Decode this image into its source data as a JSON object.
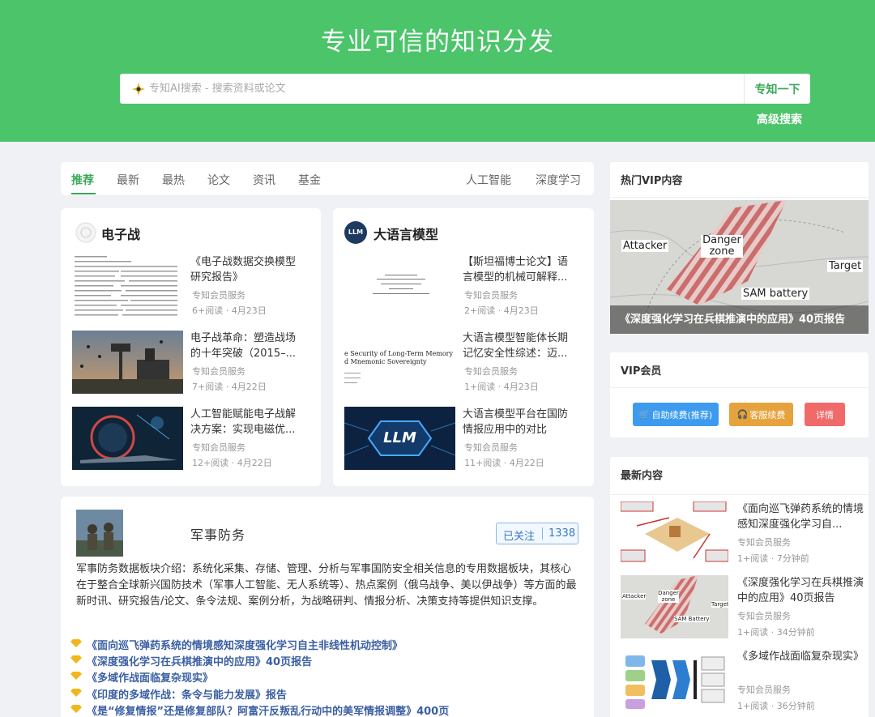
{
  "hero": {
    "title": "专业可信的知识分发",
    "search_placeholder": "专知AI搜索 - 搜索资料或论文",
    "search_button": "专知一下",
    "advanced": "高级搜索"
  },
  "tabs": {
    "left": [
      "推荐",
      "最新",
      "最热",
      "论文",
      "资讯",
      "基金"
    ],
    "right": [
      "人工智能",
      "深度学习"
    ],
    "active": "推荐"
  },
  "topics": [
    {
      "title": "电子战",
      "articles": [
        {
          "title": "《电子战数据交换模型研究报告》",
          "source": "专知会员服务",
          "meta": "6+阅读 · 4月23日"
        },
        {
          "title": "电子战革命：塑造战场的十年突破（2015–...",
          "source": "专知会员服务",
          "meta": "7+阅读 · 4月22日"
        },
        {
          "title": "人工智能赋能电子战解决方案：实现电磁优...",
          "source": "专知会员服务",
          "meta": "12+阅读 · 4月22日"
        }
      ]
    },
    {
      "title": "大语言模型",
      "logo_text": "LLM",
      "articles": [
        {
          "title": "【斯坦福博士论文】语言模型的机械可解释...",
          "source": "专知会员服务",
          "meta": "2+阅读 · 4月23日"
        },
        {
          "title": "大语言模型智能体长期记忆安全性综述：迈...",
          "source": "专知会员服务",
          "meta": "1+阅读 · 4月23日",
          "thumb_text": [
            "e Security of Long-Term Memory",
            "d Mnemonic Sovereignty"
          ]
        },
        {
          "title": "大语言模型平台在国防情报应用中的对比",
          "source": "专知会员服务",
          "meta": "11+阅读 · 4月22日",
          "thumb_text": [
            "LLM"
          ]
        }
      ]
    }
  ],
  "military": {
    "title": "军事防务",
    "follow_label": "已关注",
    "follow_count": "1338",
    "description": "军事防务数据板块介绍：系统化采集、存储、管理、分析与军事国防安全相关信息的专用数据板块，其核心在于整合全球新兴国防技术（军事人工智能、无人系统等）、热点案例（俄乌战争、美以伊战争）等方面的最新时讯、研究报告/论文、条令法规、案例分析，为战略研判、情报分析、决策支持等提供知识支撑。",
    "links": [
      "《面向巡飞弹药系统的情境感知深度强化学习自主非线性机动控制》",
      "《深度强化学习在兵棋推演中的应用》40页报告",
      "《多域作战面临复杂现实》",
      "《印度的多域作战：条令与能力发展》报告",
      "《是“修复情报”还是修复部队？阿富汗反叛乱行动中的美军情报调整》400页"
    ]
  },
  "sidebar": {
    "hot_vip": {
      "heading": "热门VIP内容",
      "caption": "《深度强化学习在兵棋推演中的应用》40页报告",
      "map_labels": {
        "attacker": "Attacker",
        "danger": "Danger zone",
        "target": "Target",
        "sam": "SAM battery"
      }
    },
    "vip": {
      "heading": "VIP会员",
      "buttons": [
        "自助续费(推荐)",
        "客服续费",
        "详情"
      ],
      "colors": {
        "blue": "#3d9bef",
        "orange": "#e6a23c",
        "red": "#f06a6a"
      }
    },
    "latest": {
      "heading": "最新内容",
      "items": [
        {
          "title": "《面向巡飞弹药系统的情境感知深度强化学习自...",
          "source": "专知会员服务",
          "meta": "1+阅读 · 7分钟前"
        },
        {
          "title": "《深度强化学习在兵棋推演中的应用》40页报告",
          "source": "专知会员服务",
          "meta": "1+阅读 · 34分钟前",
          "thumb_labels": {
            "attacker": "Attacker",
            "danger": "Danger zone",
            "target": "Target",
            "sam": "SAM Battery"
          }
        },
        {
          "title": "《多域作战面临复杂现实》",
          "source": "专知会员服务",
          "meta": "1+阅读 · 36分钟前"
        }
      ]
    }
  },
  "colors": {
    "brand_green": "#4bc46a",
    "link_blue": "#3a5fa2"
  }
}
